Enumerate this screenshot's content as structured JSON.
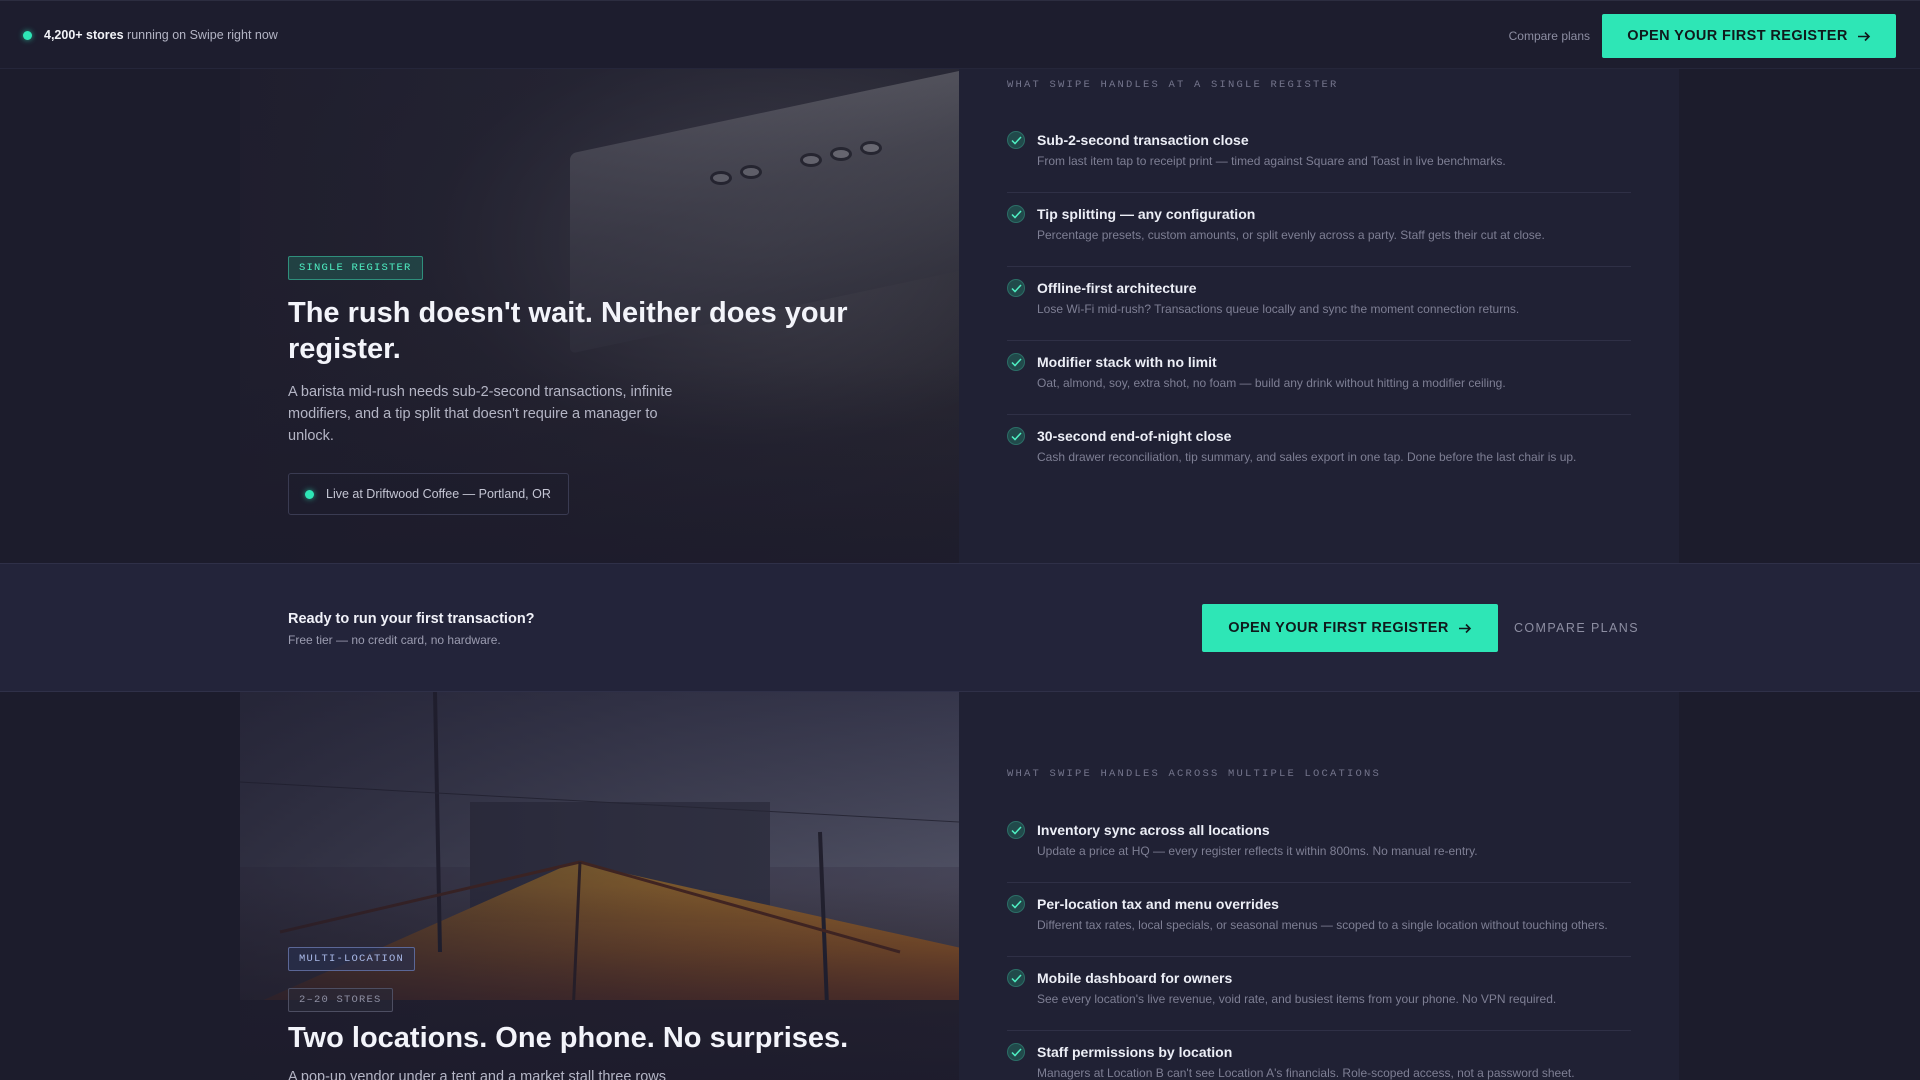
{
  "topbar": {
    "status_count": "4,200+ stores",
    "status_rest": " running on Swipe right now",
    "compare_label": "Compare plans",
    "cta_label": "OPEN YOUR FIRST REGISTER",
    "cta_icon": "arrow-right-icon"
  },
  "single": {
    "tag": "SINGLE REGISTER",
    "headline": "The rush doesn't wait. Neither does your register.",
    "lede": "A barista mid-rush needs sub-2-second transactions, infinite modifiers, and a tip split that doesn't require a manager to unlock.",
    "location": "Live at Driftwood Coffee — Portland, OR",
    "eyebrow": "WHAT SWIPE HANDLES AT A SINGLE REGISTER",
    "features": [
      {
        "title": "Sub-2-second transaction close",
        "desc": "From last item tap to receipt print — timed against Square and Toast in live benchmarks."
      },
      {
        "title": "Tip splitting — any configuration",
        "desc": "Percentage presets, custom amounts, or split evenly across a party. Staff gets their cut at close."
      },
      {
        "title": "Offline-first architecture",
        "desc": "Lose Wi-Fi mid-rush? Transactions queue locally and sync the moment connection returns."
      },
      {
        "title": "Modifier stack with no limit",
        "desc": "Oat, almond, soy, extra shot, no foam — build any drink without hitting a modifier ceiling."
      },
      {
        "title": "30-second end-of-night close",
        "desc": "Cash drawer reconciliation, tip summary, and sales export in one tap. Done before the last chair is up."
      }
    ]
  },
  "cta": {
    "title": "Ready to run your first transaction?",
    "sub": "Free tier — no credit card, no hardware.",
    "button": "OPEN YOUR FIRST REGISTER",
    "compare": "COMPARE PLANS"
  },
  "multi": {
    "tag": "MULTI-LOCATION",
    "size_tag": "2–20 STORES",
    "headline": "Two locations. One phone. No surprises.",
    "lede": "A pop-up vendor under a tent and a market stall three rows",
    "eyebrow": "WHAT SWIPE HANDLES ACROSS MULTIPLE LOCATIONS",
    "features": [
      {
        "title": "Inventory sync across all locations",
        "desc": "Update a price at HQ — every register reflects it within 800ms. No manual re-entry."
      },
      {
        "title": "Per-location tax and menu overrides",
        "desc": "Different tax rates, local specials, or seasonal menus — scoped to a single location without touching others."
      },
      {
        "title": "Mobile dashboard for owners",
        "desc": "See every location's live revenue, void rate, and busiest items from your phone. No VPN required."
      },
      {
        "title": "Staff permissions by location",
        "desc": "Managers at Location B can't see Location A's financials. Role-scoped access, not a password sheet."
      }
    ]
  },
  "colors": {
    "accent": "#2ee6b6",
    "background": "#1c1c2c",
    "panel": "#202134"
  }
}
